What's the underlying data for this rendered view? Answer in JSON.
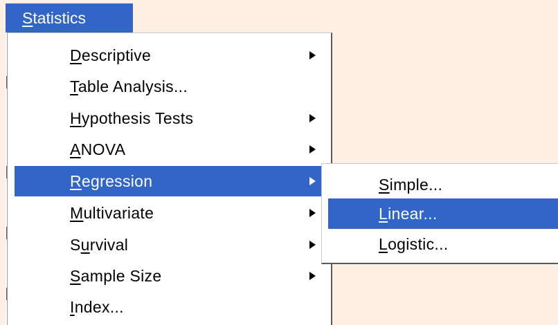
{
  "menubar": {
    "statistics": {
      "access_key": "S",
      "rest": "tatistics"
    }
  },
  "menu": {
    "items": [
      {
        "pre": "",
        "key": "D",
        "post": "escriptive",
        "submenu": true
      },
      {
        "pre": "",
        "key": "T",
        "post": "able Analysis...",
        "submenu": false
      },
      {
        "pre": "",
        "key": "H",
        "post": "ypothesis Tests",
        "submenu": true
      },
      {
        "pre": "",
        "key": "A",
        "post": "NOVA",
        "submenu": true
      },
      {
        "pre": "",
        "key": "R",
        "post": "egression",
        "submenu": true,
        "highlighted": true
      },
      {
        "pre": "",
        "key": "M",
        "post": "ultivariate",
        "submenu": true
      },
      {
        "pre": "S",
        "key": "u",
        "post": "rvival",
        "submenu": true
      },
      {
        "pre": "",
        "key": "S",
        "post": "ample Size",
        "submenu": true
      },
      {
        "pre": "",
        "key": "I",
        "post": "ndex...",
        "submenu": false
      }
    ]
  },
  "submenu": {
    "items": [
      {
        "pre": "",
        "key": "S",
        "post": "imple..."
      },
      {
        "pre": "",
        "key": "L",
        "post": "inear...",
        "highlighted": true
      },
      {
        "pre": "",
        "key": "L",
        "post": "ogistic..."
      }
    ]
  },
  "icons": {
    "submenu_arrow": "triangle-right-icon"
  },
  "colors": {
    "highlight": "#3165c8",
    "background": "#fdefe4"
  }
}
